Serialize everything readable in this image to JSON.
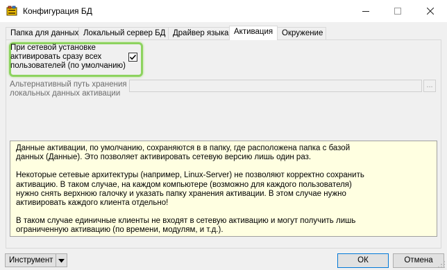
{
  "window": {
    "title": "Конфигурация БД"
  },
  "tabs": [
    {
      "label": "Папка для данных"
    },
    {
      "label": "Локальный сервер БД"
    },
    {
      "label": "Драйвер языка"
    },
    {
      "label": "Активация",
      "active": true
    },
    {
      "label": "Окружение"
    }
  ],
  "activation": {
    "network_checkbox_label": "При сетевой установке активировать сразу всех пользователей (по умолчанию)",
    "network_checkbox_checked": true,
    "alt_path_label": "Альтернативный путь хранения локальных данных активации",
    "alt_path_value": "",
    "browse_label": "..."
  },
  "info": {
    "paragraph1": "Данные активации, по умолчанию, сохраняются в в папку, где расположена папка с базой\nданных (Данные). Это позволяет активировать сетевую версию лишь один раз.",
    "paragraph2": "Некоторые сетевые архитектуры (например, Linux-Server) не позволяют корректно сохранить\nактивацию. В таком случае, на каждом компьютере (возможно для каждого пользователя)\nнужно снять верхнюю галочку и указать папку хранения активации. В этом случае нужно\nактивировать каждого клиента отдельно!",
    "paragraph3": "В таком случае единичные клиенты не входят в сетевую активацию и могут получить лишь\nограниченную активацию (по времени, модулям, и т.д.)."
  },
  "footer": {
    "tools_label": "Инструмент",
    "ok_label": "ОК",
    "cancel_label": "Отмена"
  },
  "colors": {
    "highlight": "#8dd35f",
    "info_background": "#ffffe1",
    "default_button_border": "#0078d7"
  }
}
